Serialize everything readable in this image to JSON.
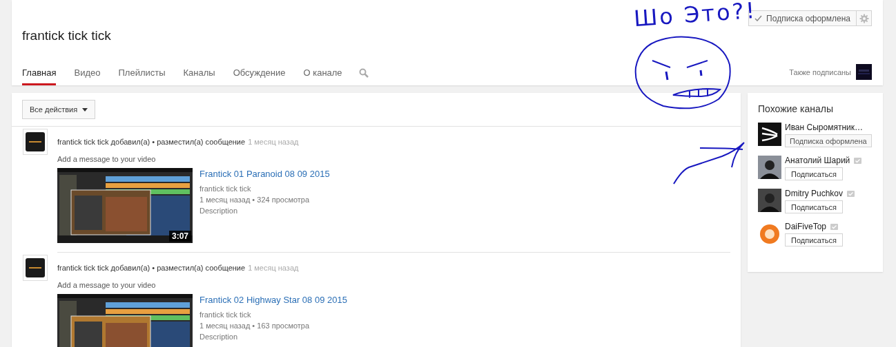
{
  "header": {
    "title": "frantick tick tick",
    "tabs": [
      {
        "label": "Главная",
        "selected": true
      },
      {
        "label": "Видео",
        "selected": false
      },
      {
        "label": "Плейлисты",
        "selected": false
      },
      {
        "label": "Каналы",
        "selected": false
      },
      {
        "label": "Обсуждение",
        "selected": false
      },
      {
        "label": "О канале",
        "selected": false
      }
    ],
    "subscribe_button": {
      "label": "Подписка оформлена",
      "subscribed": true
    },
    "also_subscribed": "Также подписаны"
  },
  "feed": {
    "actions_button": "Все действия",
    "items": [
      {
        "author": "frantick tick tick",
        "action": "добавил(а) • разместил(а) сообщение",
        "time": "1 месяц назад",
        "message": "Add a message to your video",
        "video": {
          "title": "Frantick 01 Paranoid 08 09 2015",
          "channel": "frantick tick tick",
          "stats": "1 месяц назад • 324 просмотра",
          "description": "Description",
          "duration": "3:07"
        }
      },
      {
        "author": "frantick tick tick",
        "action": "добавил(а) • разместил(а) сообщение",
        "time": "1 месяц назад",
        "message": "Add a message to your video",
        "video": {
          "title": "Frantick 02 Highway Star 08 09 2015",
          "channel": "frantick tick tick",
          "stats": "1 месяц назад • 163 просмотра",
          "description": "Description"
        }
      }
    ]
  },
  "sidebar": {
    "title": "Похожие каналы",
    "channels": [
      {
        "name": "Иван Сыромятник…",
        "verified": false,
        "button": "Подписка оформлена",
        "subscribed": true
      },
      {
        "name": "Анатолий Шарий",
        "verified": true,
        "button": "Подписаться",
        "subscribed": false
      },
      {
        "name": "Dmitry Puchkov",
        "verified": true,
        "button": "Подписаться",
        "subscribed": false
      },
      {
        "name": "DaiFiveTop",
        "verified": true,
        "button": "Подписаться",
        "subscribed": false
      }
    ]
  },
  "annotation": {
    "text": "Шо Это?!"
  }
}
